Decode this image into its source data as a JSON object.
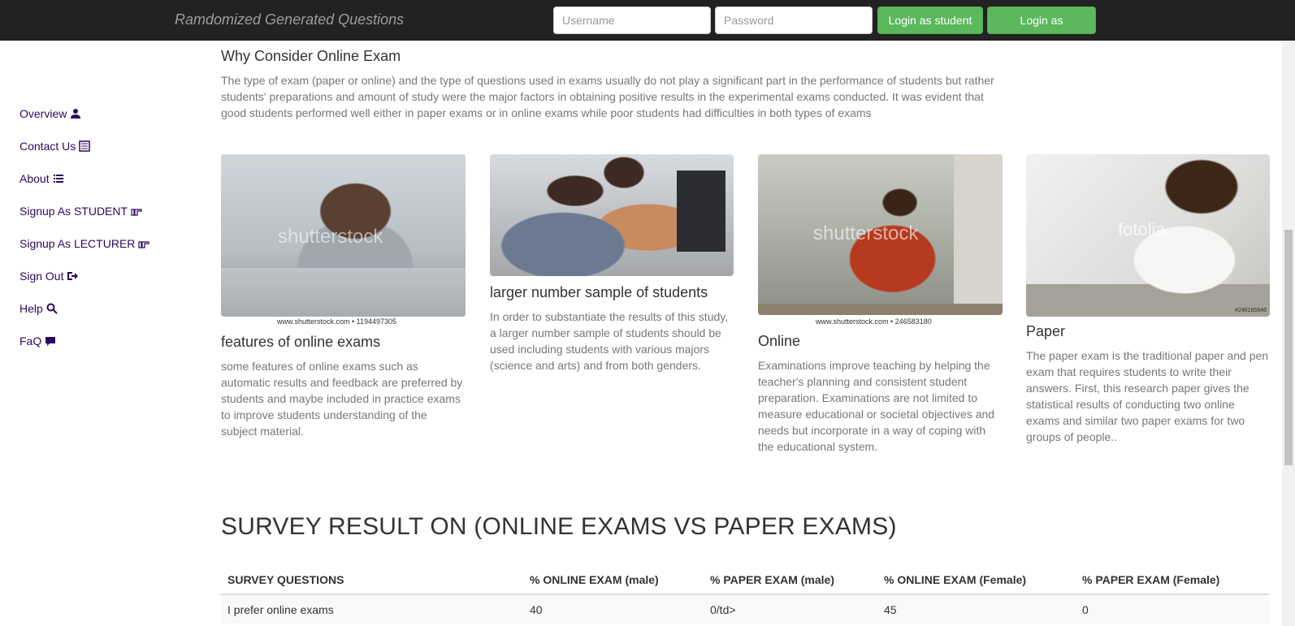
{
  "header": {
    "brand": "Ramdomized Generated Questions",
    "username_placeholder": "Username",
    "password_placeholder": "Password",
    "login_student": "Login as student",
    "login_lecturer": "Login as Lecturer"
  },
  "sidebar": {
    "items": [
      {
        "label": "Overview",
        "icon": "user-icon"
      },
      {
        "label": "Contact Us",
        "icon": "list-alt-icon"
      },
      {
        "label": "About",
        "icon": "list-icon"
      },
      {
        "label": "Signup As STUDENT",
        "icon": "hand-right-icon"
      },
      {
        "label": "Signup As LECTURER",
        "icon": "hand-right-icon"
      },
      {
        "label": "Sign Out",
        "icon": "log-out-icon"
      },
      {
        "label": "Help",
        "icon": "search-icon"
      },
      {
        "label": "FaQ",
        "icon": "comment-icon"
      }
    ]
  },
  "intro": {
    "title": "Why Consider Online Exam",
    "text": "The type of exam (paper or online) and the type of questions used in exams usually do not play a significant part in the performance of students but rather students' preparations and amount of study were the major factors in obtaining positive results in the experimental exams conducted. It was evident that good students performed well either in paper exams or in online exams while poor students had difficulties in both types of exams"
  },
  "cards": [
    {
      "title": "features of online exams",
      "caption": "www.shutterstock.com • 1194497305",
      "watermark": "shutterstock",
      "text": "some features of online exams such as automatic results and feedback are preferred by students and maybe included in practice exams to improve students understanding of the subject material."
    },
    {
      "title": "larger number sample of students",
      "caption": "",
      "watermark": "",
      "text": "In order to substantiate the results of this study, a larger number sample of students should be used including students with various majors (science and arts) and from both genders."
    },
    {
      "title": "Online",
      "caption": "www.shutterstock.com • 246583180",
      "watermark": "shutterstock",
      "text": "Examinations improve teaching by helping the teacher's planning and consistent student preparation. Examinations are not limited to measure educational or societal objectives and needs but incorporate in a way of coping with the educational system."
    },
    {
      "title": "Paper",
      "caption": "#246165646",
      "watermark": "fotolia",
      "text": "The paper exam is the traditional paper and pen exam that requires students to write their answers. First, this research paper gives the statistical results of conducting two online exams and similar two paper exams for two groups of people.."
    }
  ],
  "survey": {
    "title": "SURVEY RESULT ON (ONLINE EXAMS VS PAPER EXAMS)",
    "headers": [
      "SURVEY QUESTIONS",
      "% ONLINE EXAM (male)",
      "% PAPER EXAM (male)",
      "% ONLINE EXAM (Female)",
      "% PAPER EXAM (Female)"
    ],
    "rows": [
      [
        "I prefer online exams",
        "40",
        "0/td>",
        "45",
        "0"
      ]
    ]
  }
}
